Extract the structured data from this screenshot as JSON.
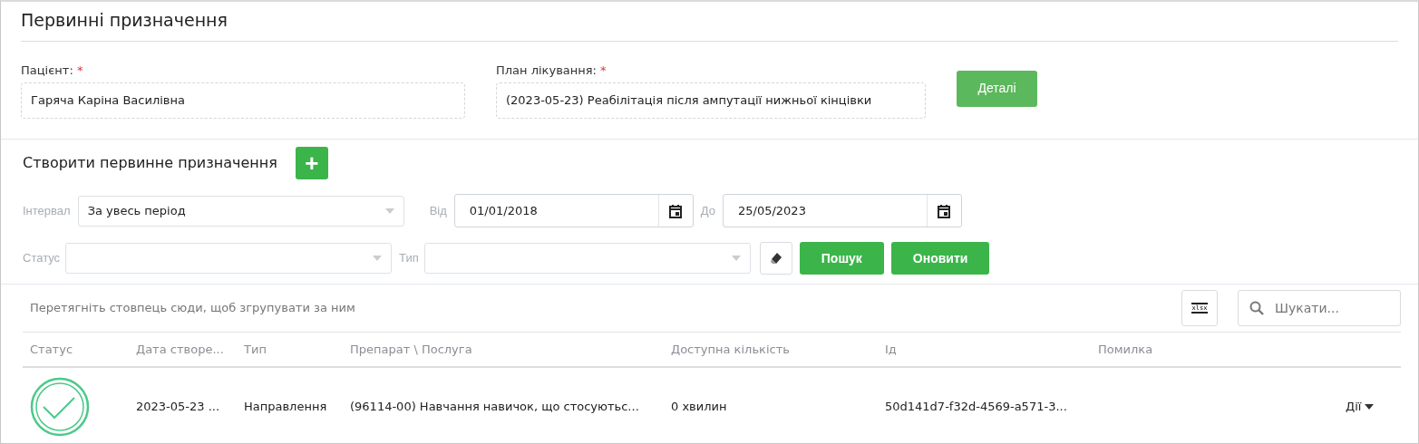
{
  "title": "Первинні призначення",
  "patient": {
    "label": "Пацієнт:",
    "required_mark": "*",
    "value": "Гаряча Каріна Василівна"
  },
  "plan": {
    "label": "План лікування:",
    "required_mark": "*",
    "value": "(2023-05-23) Реабілітація після ампутації нижньої кінцівки"
  },
  "details_button": "Деталі",
  "create": {
    "label": "Створити первинне призначення",
    "button": "+"
  },
  "filters": {
    "interval_label": "Інтервал",
    "interval_value": "За увесь період",
    "from_label": "Від",
    "from_value": "01/01/2018",
    "to_label": "До",
    "to_value": "25/05/2023",
    "status_label": "Статус",
    "type_label": "Тип"
  },
  "buttons": [
    "Пошук",
    "Оновити"
  ],
  "grid": {
    "group_hint": "Перетягніть стовпець сюди, щоб згрупувати за ним",
    "export_label": "xlsx",
    "search_placeholder": "Шукати...",
    "columns": [
      "Статус",
      "Дата створе...",
      "Тип",
      "Препарат \\ Послуга",
      "Доступна кількість",
      "Ід",
      "Помилка"
    ],
    "rows": [
      {
        "completed": true,
        "created": "2023-05-23 ...",
        "type": "Направлення",
        "item": "(96114-00) Навчання навичок, що стосуютьс...",
        "quantity": "0 хвилин",
        "id": "50d141d7-f32d-4569-a571-3...",
        "actions": "Дії"
      }
    ]
  }
}
